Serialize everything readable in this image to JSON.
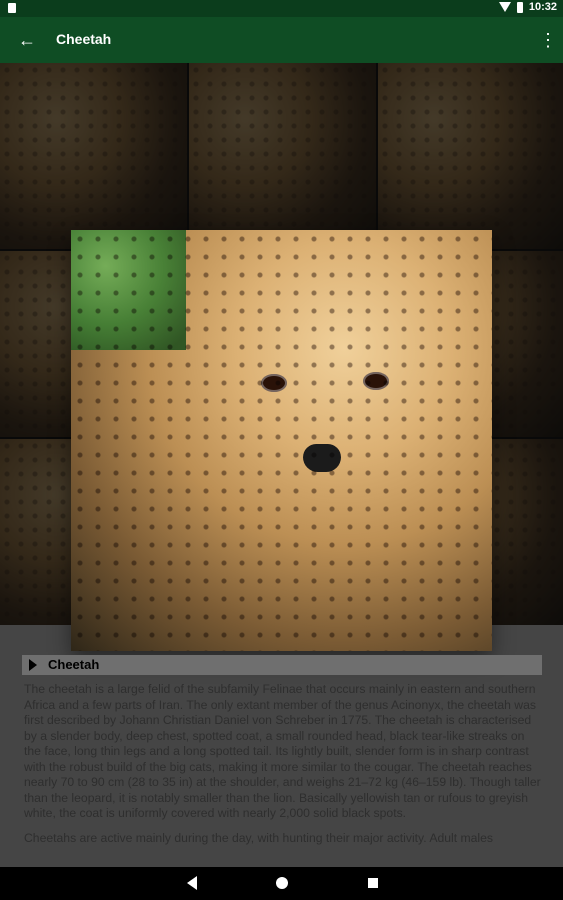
{
  "statusbar": {
    "time": "10:32"
  },
  "appbar": {
    "title": "Cheetah"
  },
  "section": {
    "title": "Cheetah"
  },
  "description": {
    "p1": "The cheetah is a large felid of the subfamily Felinae that occurs mainly in eastern and southern Africa and a few parts of Iran. The only extant member of the genus Acinonyx, the cheetah was first described by Johann Christian Daniel von Schreber in 1775. The cheetah is characterised by a slender body, deep chest, spotted coat, a small rounded head, black tear-like streaks on the face, long thin legs and a long spotted tail. Its lightly built, slender form is in sharp contrast with the robust build of the big cats, making it more similar to the cougar. The cheetah reaches nearly 70 to 90 cm (28 to 35 in) at the shoulder, and weighs 21–72 kg (46–159 lb). Though taller than the leopard, it is notably smaller than the lion. Basically yellowish tan or rufous to greyish white, the coat is uniformly covered with nearly 2,000 solid black spots.",
    "p2": "Cheetahs are active mainly during the day, with hunting their major activity. Adult males"
  },
  "icons": {
    "back": "arrow-left-icon",
    "more": "more-vert-icon",
    "nav_back": "triangle-back-icon",
    "nav_home": "circle-home-icon",
    "nav_recents": "square-recents-icon"
  },
  "colors": {
    "statusbar": "#0b3d1c",
    "appbar": "#0f4d24",
    "content_bg": "#7e7e7e"
  }
}
